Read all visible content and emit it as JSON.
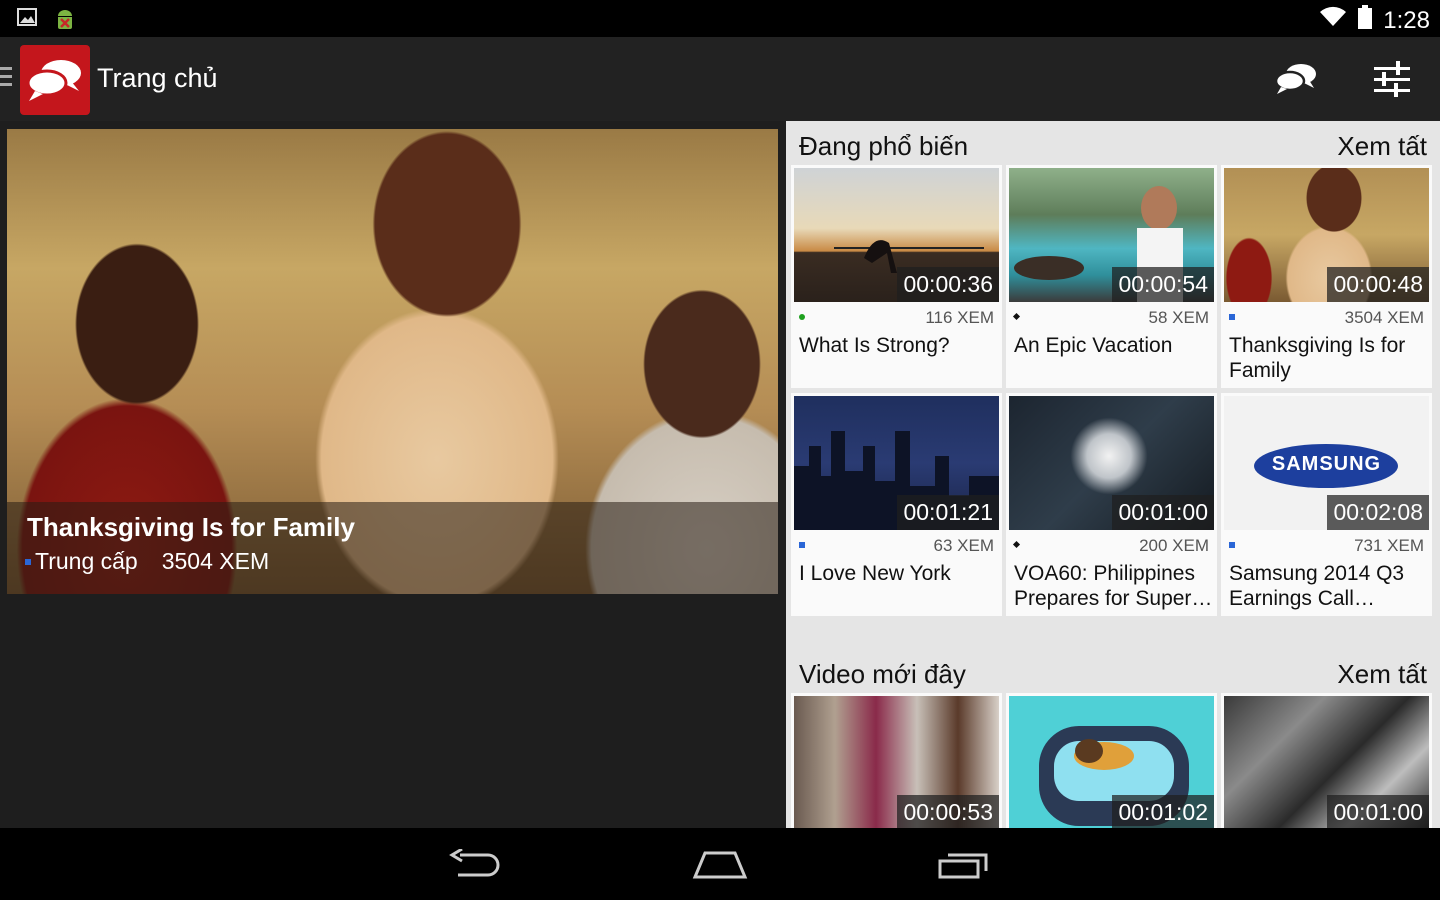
{
  "status_bar": {
    "time": "1:28",
    "left_icons": [
      "image-icon",
      "android-debug-icon"
    ],
    "right_icons": [
      "wifi-icon",
      "battery-icon"
    ]
  },
  "app_bar": {
    "title": "Trang chủ",
    "icons": [
      "app-logo-chat-icon",
      "chat-bubbles-icon",
      "sliders-icon"
    ]
  },
  "hero": {
    "title": "Thanksgiving Is for Family",
    "level": "Trung cấp",
    "views": "3504 XEM",
    "level_color": "#2a66d6"
  },
  "popular": {
    "title": "Đang phổ biến",
    "see_all": "Xem tất",
    "items": [
      {
        "duration": "00:00:36",
        "views": "116 XEM",
        "title": "What Is Strong?",
        "indicator": "green"
      },
      {
        "duration": "00:00:54",
        "views": "58 XEM",
        "title": "An Epic Vacation",
        "indicator": "diamond"
      },
      {
        "duration": "00:00:48",
        "views": "3504 XEM",
        "title": "Thanksgiving Is for Family",
        "indicator": "blue"
      },
      {
        "duration": "00:01:21",
        "views": "63 XEM",
        "title": "I Love New York",
        "indicator": "blue"
      },
      {
        "duration": "00:01:00",
        "views": "200 XEM",
        "title": "VOA60: Philippines Prepares for Super…",
        "indicator": "diamond"
      },
      {
        "duration": "00:02:08",
        "views": "731 XEM",
        "title": "Samsung 2014 Q3 Earnings Call…",
        "indicator": "blue"
      }
    ]
  },
  "recent": {
    "title": "Video mới đây",
    "see_all": "Xem tất",
    "items": [
      {
        "duration": "00:00:53"
      },
      {
        "duration": "00:01:02"
      },
      {
        "duration": "00:01:00"
      }
    ]
  },
  "thumb_text": {
    "samsung": "SAMSUNG"
  },
  "nav_bar": {
    "icons": [
      "back-icon",
      "home-icon",
      "recents-icon"
    ]
  },
  "colors": {
    "brand": "#c4161c",
    "app_bar": "#222222",
    "panel": "#e5e5e5"
  }
}
